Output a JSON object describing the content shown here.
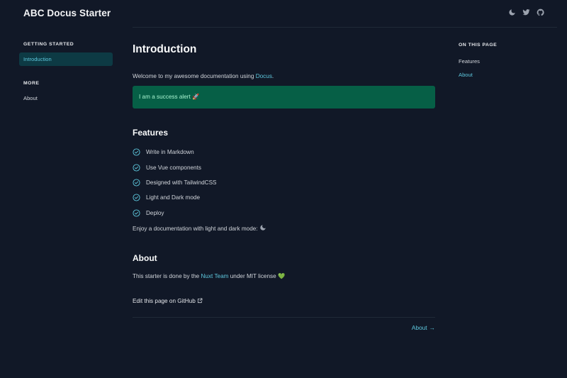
{
  "header": {
    "title": "ABC Docus Starter",
    "icons": [
      "moon-icon",
      "twitter-icon",
      "github-icon"
    ]
  },
  "sidebar": {
    "groups": [
      {
        "heading": "GETTING STARTED",
        "items": [
          {
            "label": "Introduction",
            "active": true
          }
        ]
      },
      {
        "heading": "MORE",
        "items": [
          {
            "label": "About",
            "active": false
          }
        ]
      }
    ]
  },
  "content": {
    "title": "Introduction",
    "intro_prefix": "Welcome to my awesome documentation using ",
    "intro_link": "Docus",
    "intro_suffix": ".",
    "alert": "I am a success alert 🚀",
    "features_heading": "Features",
    "features": [
      "Write in Markdown",
      "Use Vue components",
      "Designed with TailwindCSS",
      "Light and Dark mode",
      "Deploy"
    ],
    "mode_text": "Enjoy a documentation with light and dark mode: ",
    "about_heading": "About",
    "about_prefix": "This starter is done by the ",
    "about_link": "Nuxt Team",
    "about_suffix": " under MIT license ",
    "about_emoji": "💚",
    "edit_link": "Edit this page on GitHub",
    "next_link": "About",
    "next_arrow": "→"
  },
  "toc": {
    "heading": "ON THIS PAGE",
    "items": [
      {
        "label": "Features",
        "active": false
      },
      {
        "label": "About",
        "active": true
      }
    ]
  },
  "colors": {
    "background": "#111827",
    "accent": "#5ec8de",
    "alert_bg": "#065f46",
    "alert_text": "#a7f3d0"
  }
}
